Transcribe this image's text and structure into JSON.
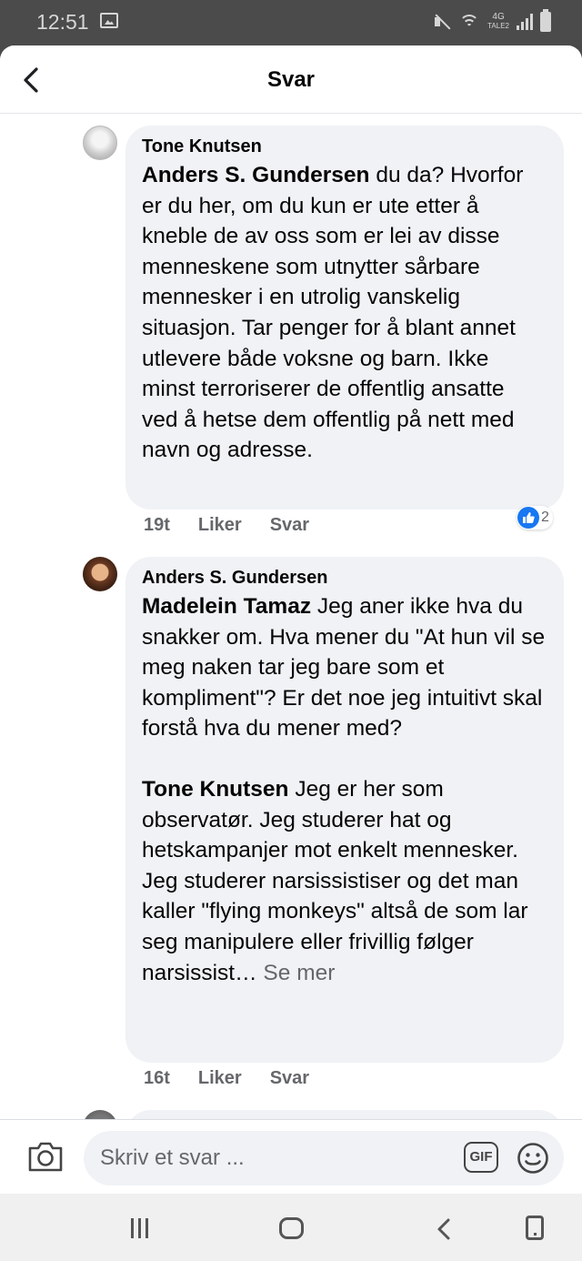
{
  "status_bar": {
    "time": "12:51",
    "network_top": "4G",
    "network_bottom": "TALE2",
    "icons": [
      "image-icon",
      "mute-icon",
      "wifi-icon",
      "signal-icon",
      "battery-icon"
    ]
  },
  "header": {
    "title": "Svar",
    "back_icon": "chevron-left-icon"
  },
  "comments": [
    {
      "author": "Tone Knutsen",
      "mention": "Anders S. Gundersen",
      "text": " du da? Hvorfor er du her, om du kun er ute etter å kneble de av oss som er lei av disse menneskene som utnytter sårbare mennesker i en utrolig vanskelig situasjon. Tar penger for å blant annet utlevere både voksne og barn. Ikke minst terroriserer de offentlig ansatte ved å hetse dem offentlig på nett med navn og adresse.",
      "time": "19t",
      "like_label": "Liker",
      "reply_label": "Svar",
      "reaction_count": "2"
    },
    {
      "author": "Anders S. Gundersen",
      "mention_1": "Madelein Tamaz",
      "text_1": " Jeg aner ikke hva du snakker om. Hva mener du \"At hun vil se meg naken tar jeg bare som et kompliment\"?  Er det noe jeg intuitivt skal forstå hva du mener med?",
      "mention_2": "Tone Knutsen",
      "text_2": " Jeg er her som observatør. Jeg studerer hat og hetskampanjer mot enkelt mennesker. Jeg studerer narsissistiser og det man kaller \"flying monkeys\" altså de som lar seg manipulere eller frivillig følger narsissist…",
      "see_more": " Se mer",
      "time": "16t",
      "like_label": "Liker",
      "reply_label": "Svar"
    }
  ],
  "composer": {
    "placeholder": "Skriv et svar ...",
    "gif_label": "GIF",
    "camera_icon": "camera-icon",
    "emoji_icon": "smiley-icon"
  },
  "colors": {
    "bubble_bg": "#f0f2f5",
    "secondary_text": "#65676b",
    "like_blue": "#1877f2"
  }
}
